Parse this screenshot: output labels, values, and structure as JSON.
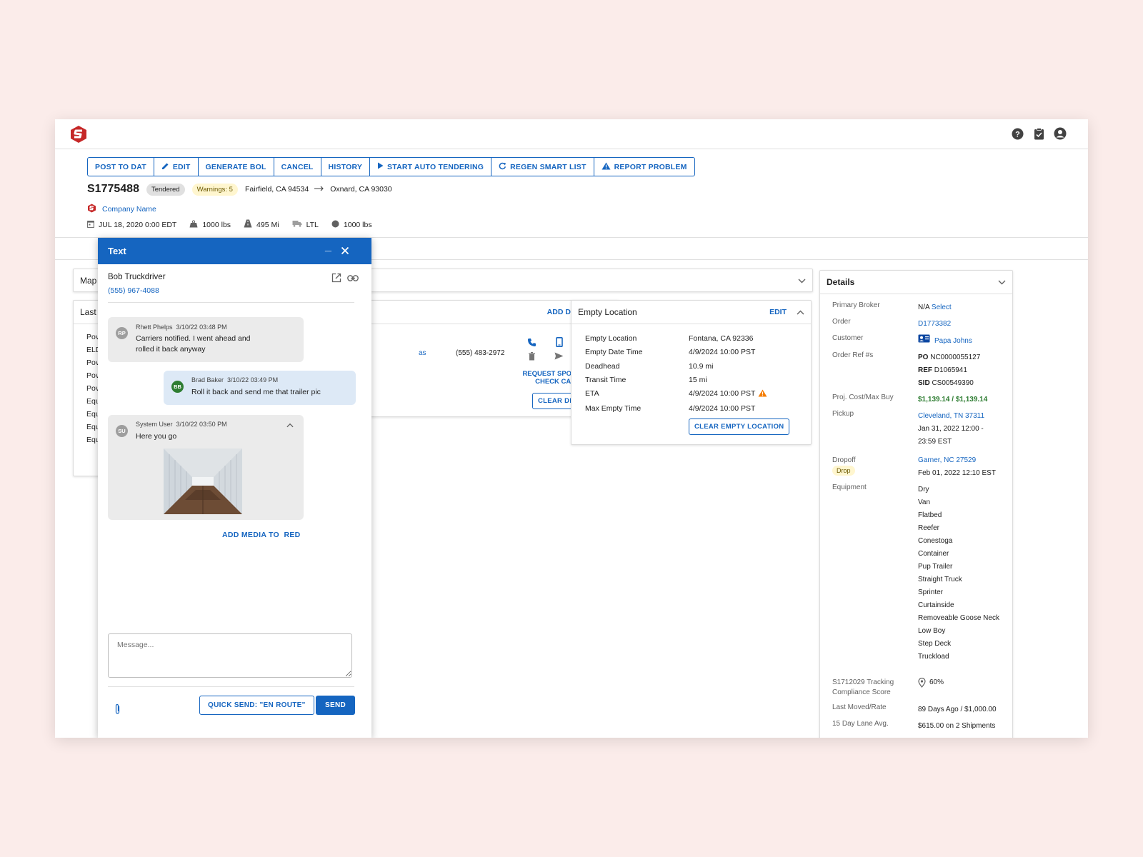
{
  "colors": {
    "primary": "#1565c0",
    "brand": "#c62828",
    "background": "#fbecea",
    "success": "#2e7d32",
    "warning": "#f57c00"
  },
  "toolbar": {
    "buttons": [
      {
        "label": "POST TO DAT",
        "icon": ""
      },
      {
        "label": "EDIT",
        "icon": "pencil-icon"
      },
      {
        "label": "GENERATE BOL",
        "icon": ""
      },
      {
        "label": "CANCEL",
        "icon": ""
      },
      {
        "label": "HISTORY",
        "icon": ""
      },
      {
        "label": "START AUTO TENDERING",
        "icon": "play-icon"
      },
      {
        "label": "REGEN SMART LIST",
        "icon": "refresh-icon"
      },
      {
        "label": "REPORT PROBLEM",
        "icon": "warning-icon"
      }
    ]
  },
  "load": {
    "id": "S1775488",
    "status": "Tendered",
    "warnings": "Warnings: 5",
    "origin": "Fairfield, CA 94534",
    "destination": "Oxnard, CA 93030",
    "company": "Company Name",
    "date": "JUL 18, 2020 0:00 EDT",
    "weight": "1000 lbs",
    "distance": "495 Mi",
    "mode": "LTL",
    "weight2": "1000 lbs"
  },
  "map_card": {
    "title": "Map"
  },
  "last_card": {
    "title": "Last",
    "rows": [
      "Pov",
      "ELD",
      "Pov",
      "Pov",
      "Pov",
      "Equ",
      "Equ",
      "Equ",
      "Equ"
    ]
  },
  "driver_card": {
    "add_driver": "ADD DRIVER",
    "partial_text": "as",
    "phone": "(555) 483-2972",
    "request_spot": "REQUEST SPOT BOT",
    "check_call": "CHECK CALL",
    "clear_driver": "CLEAR DRIVER"
  },
  "empty_location": {
    "title": "Empty Location",
    "edit": "EDIT",
    "rows": [
      {
        "k": "Empty Location",
        "v": "Fontana, CA 92336"
      },
      {
        "k": "Empty Date Time",
        "v": "4/9/2024 10:00 PST"
      },
      {
        "k": "Deadhead",
        "v": "10.9 mi"
      },
      {
        "k": "Transit Time",
        "v": "15 mi"
      },
      {
        "k": "ETA",
        "v": "4/9/2024 10:00 PST"
      },
      {
        "k": "Max Empty Time",
        "v": "4/9/2024 10:00 PST"
      }
    ],
    "clear_button": "CLEAR EMPTY LOCATION"
  },
  "details": {
    "title": "Details",
    "primary_broker_label": "Primary Broker",
    "primary_broker_value": "N/A",
    "primary_broker_select": "Select",
    "order_label": "Order",
    "order_value": "D1773382",
    "customer_label": "Customer",
    "customer_value": "Papa Johns",
    "order_ref_label": "Order Ref #s",
    "order_refs": [
      {
        "k": "PO",
        "v": "NC0000055127"
      },
      {
        "k": "REF",
        "v": "D1065941"
      },
      {
        "k": "SID",
        "v": "CS00549390"
      }
    ],
    "proj_cost_label": "Proj. Cost/Max Buy",
    "proj_cost_value": "$1,139.14 / $1,139.14",
    "pickup_label": "Pickup",
    "pickup_location": "Cleveland, TN 37311",
    "pickup_time_1": "Jan 31, 2022 12:00 -",
    "pickup_time_2": "23:59 EST",
    "dropoff_label": "Dropoff",
    "dropoff_badge": "Drop",
    "dropoff_location": "Garner, NC 27529",
    "dropoff_time": "Feb 01, 2022 12:10 EST",
    "equipment_label": "Equipment",
    "equipment": [
      "Dry",
      "Van",
      "Flatbed",
      "Reefer",
      "Conestoga",
      "Container",
      "Pup Trailer",
      "Straight Truck",
      "Sprinter",
      "Curtainside",
      "Removeable Goose Neck",
      "Low Boy",
      "Step Deck",
      "Truckload"
    ],
    "tracking_label_1": "S1712029 Tracking",
    "tracking_label_2": "Compliance Score",
    "tracking_value": "60%",
    "last_moved_label": "Last Moved/Rate",
    "last_moved_value": "89 Days Ago / $1,000.00",
    "lane_avg_label": "15 Day Lane Avg.",
    "lane_avg_value": "$615.00 on 2 Shipments"
  },
  "text_panel": {
    "title": "Text",
    "minimize": "_",
    "contact_name": "Bob Truckdriver",
    "contact_phone": "(555) 967-4088",
    "messages": [
      {
        "initials": "RP",
        "sender": "Rhett Phelps",
        "time": "3/10/22 03:48 PM",
        "line1": "Carriers notified. I went ahead and",
        "line2": "rolled it back anyway"
      },
      {
        "initials": "BB",
        "sender": "Brad Baker",
        "time": "3/10/22 03:49 PM",
        "line1": "Roll it back and send me that trailer pic"
      },
      {
        "initials": "SU",
        "sender": "System User",
        "time": "3/10/22 03:50 PM",
        "line1": "Here you go"
      }
    ],
    "add_media": "ADD MEDIA TO  RED",
    "message_placeholder": "Message...",
    "quick_send": "QUICK SEND: \"EN ROUTE\"",
    "send": "SEND"
  }
}
